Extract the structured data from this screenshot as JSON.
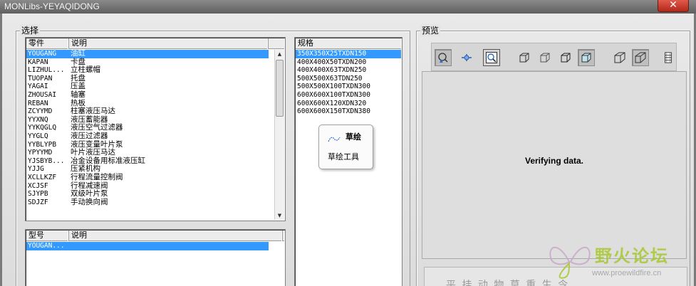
{
  "window": {
    "title": "MONLibs-YEYAQIDONG",
    "close_glyph": "✕"
  },
  "select_group": {
    "label": "选择"
  },
  "preview_group": {
    "label": "预览"
  },
  "parts_list": {
    "headers": [
      "零件",
      "说明"
    ],
    "rows": [
      [
        "YOUGANG",
        "油缸"
      ],
      [
        "KAPAN",
        "卡盘"
      ],
      [
        "LIZHUL...",
        "立柱螺帽"
      ],
      [
        "TUOPAN",
        "托盘"
      ],
      [
        "YAGAI",
        "压盖"
      ],
      [
        "ZHOUSAI",
        "轴塞"
      ],
      [
        "REBAN",
        "热板"
      ],
      [
        "ZCYYMD",
        "柱塞液压马达"
      ],
      [
        "YYXNQ",
        "液压蓄能器"
      ],
      [
        "YYKQGLQ",
        "液压空气过滤器"
      ],
      [
        "YYGLQ",
        "液压过滤器"
      ],
      [
        "YYBLYPB",
        "液压变量叶片泵"
      ],
      [
        "YPYYMD",
        "叶片液压马达"
      ],
      [
        "YJSBYB...",
        "冶金设备用标准液压缸"
      ],
      [
        "YJJG",
        "压紧机构"
      ],
      [
        "XCLLKZF",
        "行程流量控制阀"
      ],
      [
        "XCJSF",
        "行程减速阀"
      ],
      [
        "SJYPB",
        "双级叶片泵"
      ],
      [
        "SDJZF",
        "手动换向阀"
      ]
    ],
    "selected_index": 0
  },
  "spec_list": {
    "header": "规格",
    "rows": [
      "350X350X25TXDN150",
      "400X400X50TXDN200",
      "400X400X63TXDN250",
      "500X500X63TDN250",
      "500X500X100TXDN300",
      "600X600X100TXDN300",
      "600X600X120XDN320",
      "600X600X150TXDN380"
    ],
    "selected_index": 0
  },
  "model_list": {
    "headers": [
      "型号",
      "说明"
    ],
    "rows": [
      [
        "YOUGAN...",
        ""
      ]
    ],
    "selected_index": 0
  },
  "context_menu": {
    "items": [
      {
        "label": "草绘",
        "icon": "sketch-icon"
      },
      {
        "label": "草绘工具"
      }
    ]
  },
  "toolbar": {
    "buttons": [
      {
        "name": "regenerate-icon",
        "pressed": true
      },
      {
        "name": "orient-icon",
        "pressed": false
      },
      {
        "name": "zoom-fit-icon",
        "pressed": false
      },
      {
        "name": "wireframe-icon",
        "pressed": false
      },
      {
        "name": "hidden-line-icon",
        "pressed": false
      },
      {
        "name": "no-hidden-icon",
        "pressed": false
      },
      {
        "name": "shaded-icon",
        "pressed": true
      },
      {
        "name": "isometric-icon",
        "pressed": false
      },
      {
        "name": "trimetric-icon",
        "pressed": true
      },
      {
        "name": "film-strip-icon",
        "pressed": false
      }
    ]
  },
  "preview": {
    "status": "Verifying data."
  },
  "watermark": {
    "text": "野火论坛",
    "url": "www.proewildfire.cn"
  },
  "bottom_text": "平 挂 动 物   草 重 生 令",
  "colors": {
    "selection": "#3399ff",
    "accent": "#a8c832"
  }
}
